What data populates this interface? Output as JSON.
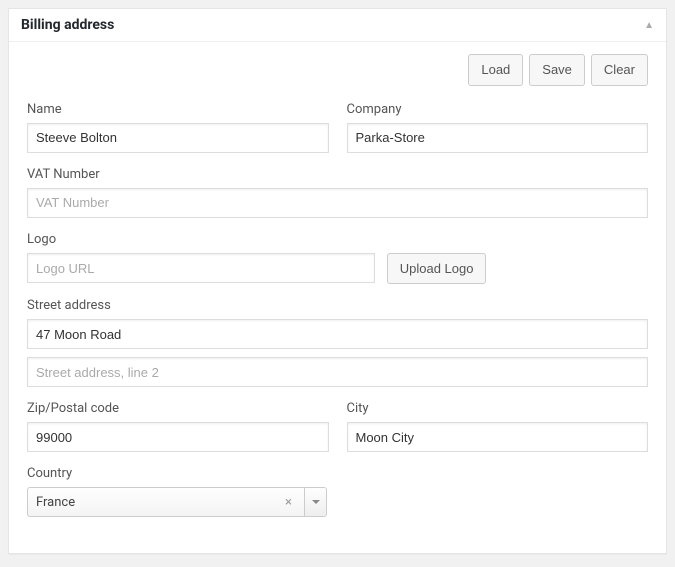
{
  "panel": {
    "title": "Billing address"
  },
  "buttons": {
    "load": "Load",
    "save": "Save",
    "clear": "Clear",
    "upload_logo": "Upload Logo"
  },
  "labels": {
    "name": "Name",
    "company": "Company",
    "vat": "VAT Number",
    "logo": "Logo",
    "street": "Street address",
    "zip": "Zip/Postal code",
    "city": "City",
    "country": "Country"
  },
  "values": {
    "name": "Steeve Bolton",
    "company": "Parka-Store",
    "vat": "",
    "logo": "",
    "street1": "47 Moon Road",
    "street2": "",
    "zip": "99000",
    "city": "Moon City",
    "country": "France"
  },
  "placeholders": {
    "vat": "VAT Number",
    "logo": "Logo URL",
    "street2": "Street address, line 2"
  }
}
